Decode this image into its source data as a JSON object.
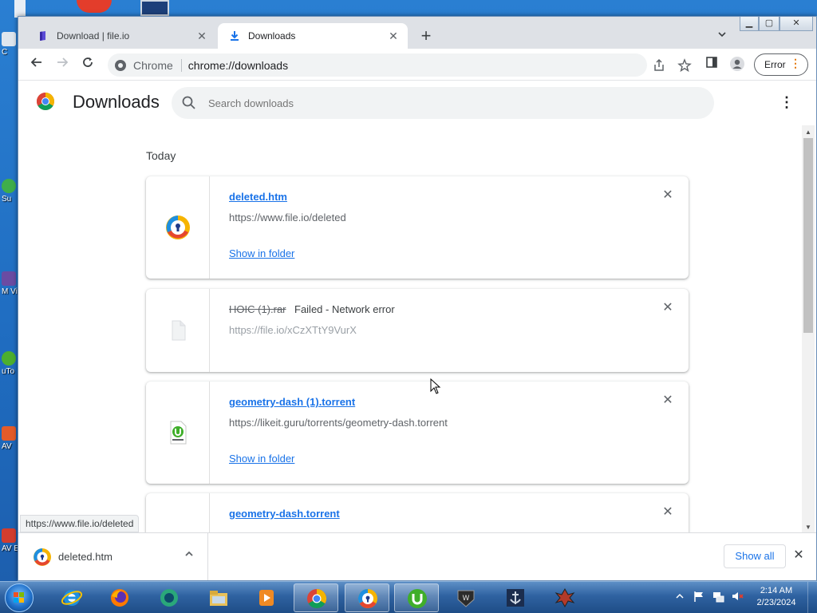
{
  "desktop": {
    "icon_labels": [
      "C",
      "Su",
      "M Vis",
      "uTo",
      "AV",
      "AV E"
    ]
  },
  "tabs": [
    {
      "title": "Download | file.io",
      "active": false
    },
    {
      "title": "Downloads",
      "active": true
    }
  ],
  "toolbar": {
    "site_chip": "Chrome",
    "url": "chrome://downloads",
    "profile_button": "Error"
  },
  "page": {
    "title": "Downloads",
    "search_placeholder": "Search downloads",
    "section_label": "Today"
  },
  "downloads": [
    {
      "name": "deleted.htm",
      "url": "https://www.file.io/deleted",
      "status": "",
      "action": "Show in folder",
      "failed": false
    },
    {
      "name": "HOIC (1).rar",
      "url": "https://file.io/xCzXTtY9VurX",
      "status": "Failed - Network error",
      "action": "",
      "failed": true
    },
    {
      "name": "geometry-dash (1).torrent",
      "url": "https://likeit.guru/torrents/geometry-dash.torrent",
      "status": "",
      "action": "Show in folder",
      "failed": false
    },
    {
      "name": "geometry-dash.torrent",
      "url": "",
      "status": "",
      "action": "",
      "failed": false
    }
  ],
  "status_url": "https://www.file.io/deleted",
  "download_bar": {
    "item_name": "deleted.htm",
    "show_all": "Show all"
  },
  "taskbar": {
    "time": "2:14 AM",
    "date": "2/23/2024"
  },
  "colors": {
    "link": "#1a73e8",
    "accent_orange": "#e37400",
    "desktop_blue": "#1f6cc0"
  }
}
